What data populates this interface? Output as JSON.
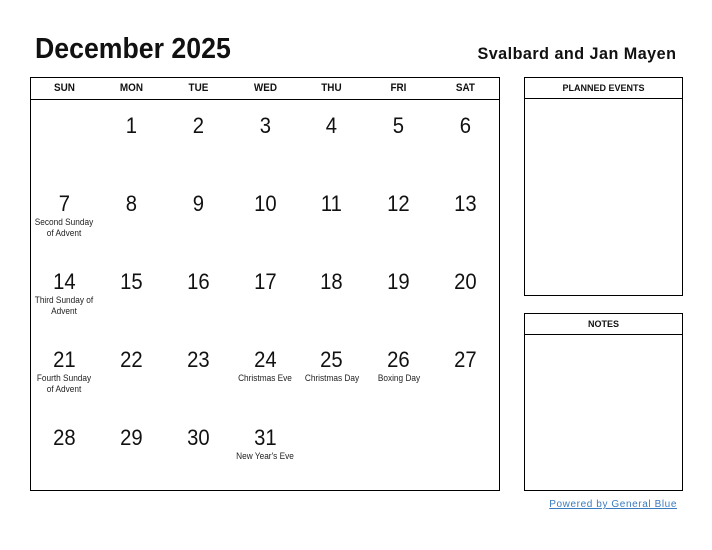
{
  "header": {
    "title": "December 2025",
    "region": "Svalbard and Jan Mayen"
  },
  "calendar": {
    "weekdays": [
      "SUN",
      "MON",
      "TUE",
      "WED",
      "THU",
      "FRI",
      "SAT"
    ],
    "weeks": [
      [
        {
          "day": "",
          "event": ""
        },
        {
          "day": "1",
          "event": ""
        },
        {
          "day": "2",
          "event": ""
        },
        {
          "day": "3",
          "event": ""
        },
        {
          "day": "4",
          "event": ""
        },
        {
          "day": "5",
          "event": ""
        },
        {
          "day": "6",
          "event": ""
        }
      ],
      [
        {
          "day": "7",
          "event": "Second Sunday of Advent"
        },
        {
          "day": "8",
          "event": ""
        },
        {
          "day": "9",
          "event": ""
        },
        {
          "day": "10",
          "event": ""
        },
        {
          "day": "11",
          "event": ""
        },
        {
          "day": "12",
          "event": ""
        },
        {
          "day": "13",
          "event": ""
        }
      ],
      [
        {
          "day": "14",
          "event": "Third Sunday of Advent"
        },
        {
          "day": "15",
          "event": ""
        },
        {
          "day": "16",
          "event": ""
        },
        {
          "day": "17",
          "event": ""
        },
        {
          "day": "18",
          "event": ""
        },
        {
          "day": "19",
          "event": ""
        },
        {
          "day": "20",
          "event": ""
        }
      ],
      [
        {
          "day": "21",
          "event": "Fourth Sunday of Advent"
        },
        {
          "day": "22",
          "event": ""
        },
        {
          "day": "23",
          "event": ""
        },
        {
          "day": "24",
          "event": "Christmas Eve"
        },
        {
          "day": "25",
          "event": "Christmas Day"
        },
        {
          "day": "26",
          "event": "Boxing Day"
        },
        {
          "day": "27",
          "event": ""
        }
      ],
      [
        {
          "day": "28",
          "event": ""
        },
        {
          "day": "29",
          "event": ""
        },
        {
          "day": "30",
          "event": ""
        },
        {
          "day": "31",
          "event": "New Year's Eve"
        },
        {
          "day": "",
          "event": ""
        },
        {
          "day": "",
          "event": ""
        },
        {
          "day": "",
          "event": ""
        }
      ]
    ]
  },
  "side": {
    "planned_events_label": "PLANNED EVENTS",
    "notes_label": "NOTES"
  },
  "footer": {
    "powered_by": "Powered by General Blue",
    "link_color": "#3a7bbf"
  }
}
